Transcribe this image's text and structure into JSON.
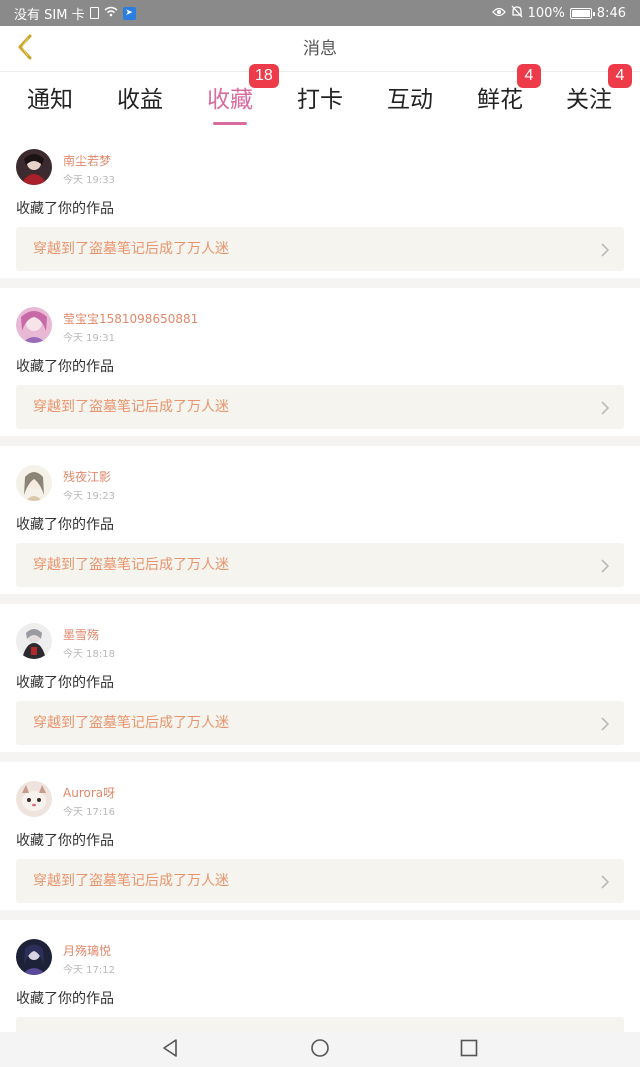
{
  "status_bar": {
    "carrier": "没有 SIM 卡",
    "battery": "100%",
    "time": "8:46",
    "icons": [
      "sim-icon",
      "wifi-icon",
      "app-notification-icon",
      "eye-icon",
      "mute-bell-icon",
      "battery-icon"
    ]
  },
  "header": {
    "title": "消息",
    "back_icon": "chevron-left-icon"
  },
  "tabs": [
    {
      "label": "通知",
      "active": false,
      "badge": ""
    },
    {
      "label": "收益",
      "active": false,
      "badge": ""
    },
    {
      "label": "收藏",
      "active": true,
      "badge": "18"
    },
    {
      "label": "打卡",
      "active": false,
      "badge": ""
    },
    {
      "label": "互动",
      "active": false,
      "badge": ""
    },
    {
      "label": "鲜花",
      "active": false,
      "badge": "4"
    },
    {
      "label": "关注",
      "active": false,
      "badge": "4"
    }
  ],
  "messages": [
    {
      "username": "南尘若梦",
      "time": "今天 19:33",
      "action": "收藏了你的作品",
      "work_title": "穿越到了盗墓笔记后成了万人迷"
    },
    {
      "username": "莹宝宝1581098650881",
      "time": "今天 19:31",
      "action": "收藏了你的作品",
      "work_title": "穿越到了盗墓笔记后成了万人迷"
    },
    {
      "username": "残夜江影",
      "time": "今天 19:23",
      "action": "收藏了你的作品",
      "work_title": "穿越到了盗墓笔记后成了万人迷"
    },
    {
      "username": "墨雪殇",
      "time": "今天 18:18",
      "action": "收藏了你的作品",
      "work_title": "穿越到了盗墓笔记后成了万人迷"
    },
    {
      "username": "Aurora呀",
      "time": "今天 17:16",
      "action": "收藏了你的作品",
      "work_title": "穿越到了盗墓笔记后成了万人迷"
    },
    {
      "username": "月殇璃悦",
      "time": "今天 17:12",
      "action": "收藏了你的作品",
      "work_title": ""
    }
  ],
  "nav_bar": {
    "icons": [
      "back-triangle-icon",
      "home-circle-icon",
      "recents-square-icon"
    ]
  },
  "colors": {
    "accent": "#d96c9e",
    "badge": "#ee3b4a",
    "username": "#e2886b",
    "work_title": "#e8956f",
    "status_bar": "#8a8a8a"
  }
}
